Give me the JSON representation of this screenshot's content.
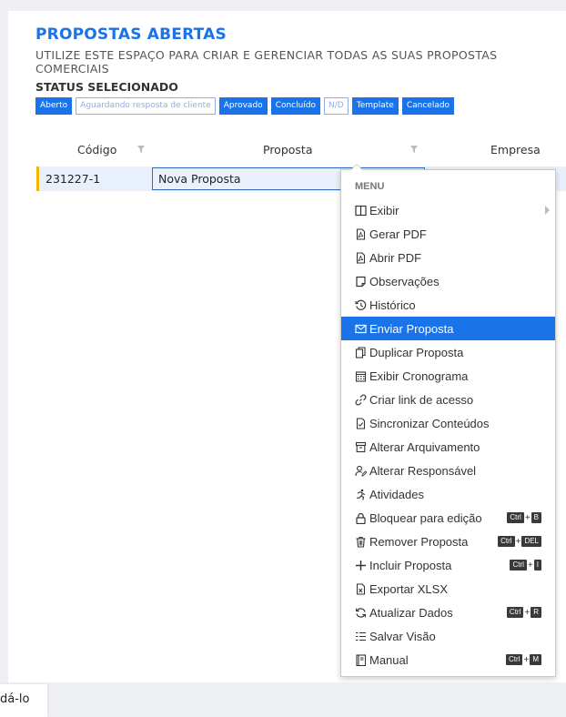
{
  "header": {
    "title": "PROPOSTAS ABERTAS",
    "subtitle": "UTILIZE ESTE ESPAÇO PARA CRIAR E GERENCIAR TODAS AS SUAS PROPOSTAS COMERCIAIS"
  },
  "status": {
    "heading": "STATUS SELECIONADO",
    "chips": [
      {
        "label": "Aberto",
        "selected": true
      },
      {
        "label": "Aguardando resposta de cliente",
        "selected": false
      },
      {
        "label": "Aprovado",
        "selected": true
      },
      {
        "label": "Concluído",
        "selected": true
      },
      {
        "label": "N/D",
        "selected": false
      },
      {
        "label": "Template",
        "selected": true
      },
      {
        "label": "Cancelado",
        "selected": true
      }
    ]
  },
  "grid": {
    "columns": [
      "Código",
      "Proposta",
      "Empresa"
    ],
    "rows": [
      {
        "codigo": "231227-1",
        "proposta": "Nova Proposta"
      }
    ]
  },
  "menu": {
    "heading": "MENU",
    "items": [
      {
        "label": "Exibir",
        "icon": "columns-icon",
        "submenu": true
      },
      {
        "label": "Gerar PDF",
        "icon": "pdf-icon"
      },
      {
        "label": "Abrir PDF",
        "icon": "pdf-icon"
      },
      {
        "label": "Observações",
        "icon": "note-icon"
      },
      {
        "label": "Histórico",
        "icon": "history-icon"
      },
      {
        "label": "Enviar Proposta",
        "icon": "envelope-icon",
        "active": true
      },
      {
        "label": "Duplicar Proposta",
        "icon": "copy-icon"
      },
      {
        "label": "Exibir Cronograma",
        "icon": "calendar-icon"
      },
      {
        "label": "Criar link de acesso",
        "icon": "link-icon"
      },
      {
        "label": "Sincronizar Conteúdos",
        "icon": "sync-file-icon"
      },
      {
        "label": "Alterar Arquivamento",
        "icon": "archive-icon"
      },
      {
        "label": "Alterar Responsável",
        "icon": "user-edit-icon"
      },
      {
        "label": "Atividades",
        "icon": "running-icon"
      },
      {
        "label": "Bloquear para edição",
        "icon": "lock-icon",
        "shortcut": [
          "Ctrl",
          "B"
        ]
      },
      {
        "label": "Remover Proposta",
        "icon": "trash-icon",
        "shortcut": [
          "Ctrl",
          "DEL"
        ]
      },
      {
        "label": "Incluir Proposta",
        "icon": "plus-icon",
        "shortcut": [
          "Ctrl",
          "I"
        ]
      },
      {
        "label": "Exportar XLSX",
        "icon": "excel-icon"
      },
      {
        "label": "Atualizar Dados",
        "icon": "refresh-icon",
        "shortcut": [
          "Ctrl",
          "R"
        ]
      },
      {
        "label": "Salvar Visão",
        "icon": "list-icon"
      },
      {
        "label": "Manual",
        "icon": "book-icon",
        "shortcut": [
          "Ctrl",
          "M"
        ]
      }
    ]
  },
  "toast": {
    "text": "dá-lo"
  },
  "colors": {
    "accent": "#1a73e8",
    "row_marker": "#f5b400",
    "row_bg": "#e8f0fc"
  }
}
